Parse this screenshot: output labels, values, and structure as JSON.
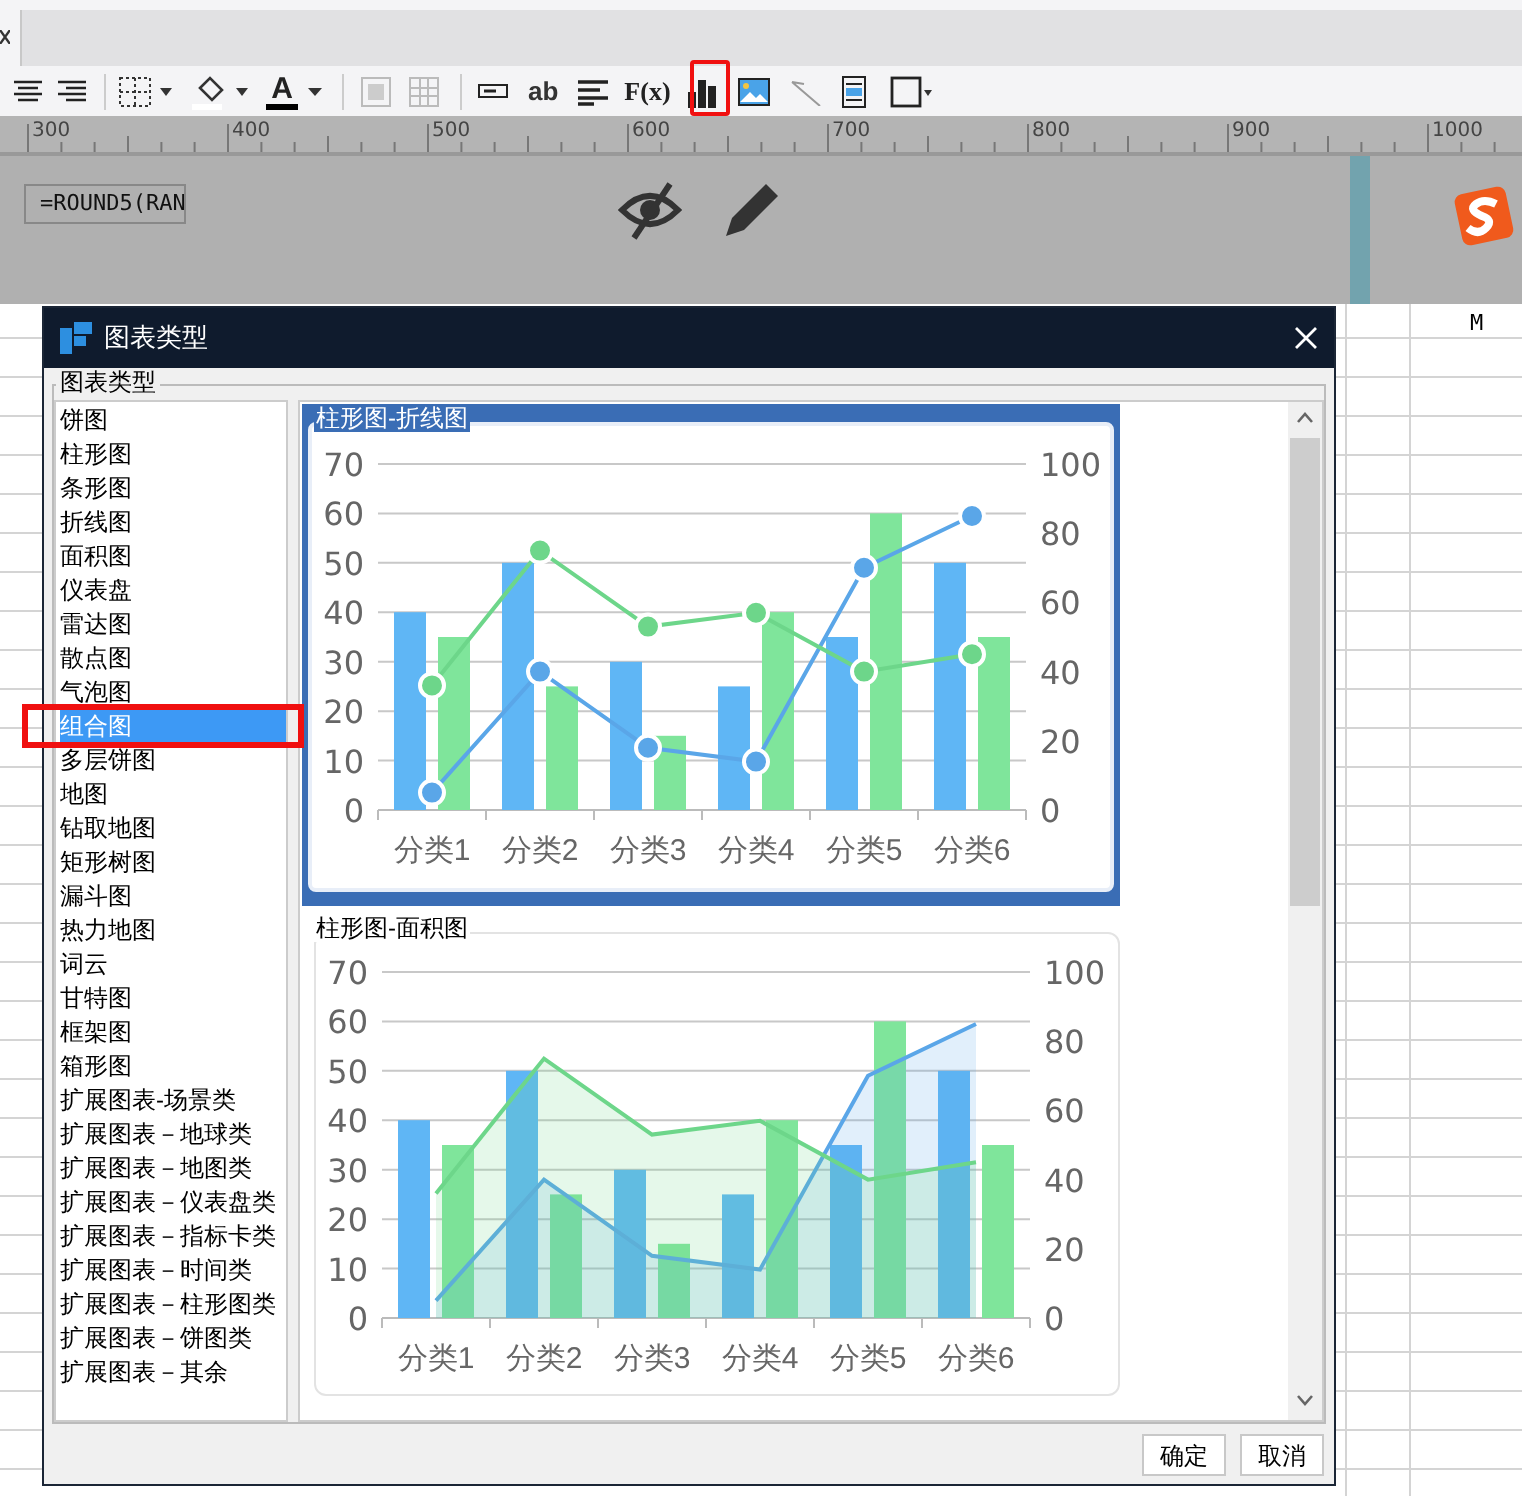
{
  "toolbar": {
    "text_buttons": [
      "A",
      "ab",
      "F(x)"
    ]
  },
  "ruler": {
    "labels": [
      "300",
      "400",
      "500",
      "600",
      "700",
      "800",
      "900",
      "1000"
    ]
  },
  "canvas": {
    "formula": "=ROUND5(RAN"
  },
  "sheet": {
    "column_headers": [
      "M"
    ]
  },
  "dialog": {
    "title": "图表类型",
    "group_label": "图表类型",
    "chart_types": [
      {
        "label": "饼图",
        "selected": false
      },
      {
        "label": "柱形图",
        "selected": false
      },
      {
        "label": "条形图",
        "selected": false
      },
      {
        "label": "折线图",
        "selected": false
      },
      {
        "label": "面积图",
        "selected": false
      },
      {
        "label": "仪表盘",
        "selected": false
      },
      {
        "label": "雷达图",
        "selected": false
      },
      {
        "label": "散点图",
        "selected": false
      },
      {
        "label": "气泡图",
        "selected": false
      },
      {
        "label": "组合图",
        "selected": true
      },
      {
        "label": "多层饼图",
        "selected": false
      },
      {
        "label": "地图",
        "selected": false
      },
      {
        "label": "钻取地图",
        "selected": false
      },
      {
        "label": "矩形树图",
        "selected": false
      },
      {
        "label": "漏斗图",
        "selected": false
      },
      {
        "label": "热力地图",
        "selected": false
      },
      {
        "label": "词云",
        "selected": false
      },
      {
        "label": "甘特图",
        "selected": false
      },
      {
        "label": "框架图",
        "selected": false
      },
      {
        "label": "箱形图",
        "selected": false
      },
      {
        "label": "扩展图表-场景类",
        "selected": false
      },
      {
        "label": "扩展图表－地球类",
        "selected": false
      },
      {
        "label": "扩展图表－地图类",
        "selected": false
      },
      {
        "label": "扩展图表－仪表盘类",
        "selected": false
      },
      {
        "label": "扩展图表－指标卡类",
        "selected": false
      },
      {
        "label": "扩展图表－时间类",
        "selected": false
      },
      {
        "label": "扩展图表－柱形图类",
        "selected": false
      },
      {
        "label": "扩展图表－饼图类",
        "selected": false
      },
      {
        "label": "扩展图表－其余",
        "selected": false
      }
    ],
    "previews": [
      {
        "title": "柱形图-折线图",
        "selected": true,
        "bar_layer": {
          "chart_data": {
            "type": "bar",
            "categories": [
              "分类1",
              "分类2",
              "分类3",
              "分类4",
              "分类5",
              "分类6"
            ],
            "ylim": [
              0,
              70
            ],
            "yticks": [
              0,
              10,
              20,
              30,
              40,
              50,
              60,
              70
            ],
            "grid": true,
            "series": [
              {
                "color": "#5fb6f5",
                "values": [
                  40,
                  50,
                  30,
                  25,
                  35,
                  50
                ]
              },
              {
                "color": "#7fe59b",
                "values": [
                  35,
                  25,
                  15,
                  40,
                  60,
                  35
                ]
              }
            ]
          }
        },
        "line_layer": {
          "chart_data": {
            "type": "line",
            "ylim": [
              0,
              100
            ],
            "yticks": [
              0,
              20,
              40,
              60,
              80,
              100
            ],
            "series": [
              {
                "color": "#5aa6e8",
                "marker": "circle",
                "values": [
                  5,
                  40,
                  18,
                  14,
                  70,
                  85
                ]
              },
              {
                "color": "#6dd68a",
                "marker": "circle",
                "values": [
                  36,
                  75,
                  53,
                  57,
                  40,
                  45
                ]
              }
            ]
          }
        }
      },
      {
        "title": "柱形图-面积图",
        "selected": false,
        "bar_layer": {
          "chart_data": {
            "type": "bar",
            "categories": [
              "分类1",
              "分类2",
              "分类3",
              "分类4",
              "分类5",
              "分类6"
            ],
            "ylim": [
              0,
              70
            ],
            "yticks": [
              0,
              10,
              20,
              30,
              40,
              50,
              60,
              70
            ],
            "grid": true,
            "series": [
              {
                "color": "#5fb6f5",
                "values": [
                  40,
                  50,
                  30,
                  25,
                  35,
                  50
                ]
              },
              {
                "color": "#7fe59b",
                "values": [
                  35,
                  25,
                  15,
                  40,
                  60,
                  35
                ]
              }
            ]
          }
        },
        "line_layer": {
          "chart_data": {
            "type": "area",
            "ylim": [
              0,
              100
            ],
            "yticks": [
              0,
              20,
              40,
              60,
              80,
              100
            ],
            "series": [
              {
                "color": "#5aa6e8",
                "values": [
                  5,
                  40,
                  18,
                  14,
                  70,
                  85
                ]
              },
              {
                "color": "#6dd68a",
                "values": [
                  36,
                  75,
                  53,
                  57,
                  40,
                  45
                ]
              }
            ]
          }
        }
      }
    ],
    "buttons": [
      "确定",
      "取消"
    ]
  }
}
